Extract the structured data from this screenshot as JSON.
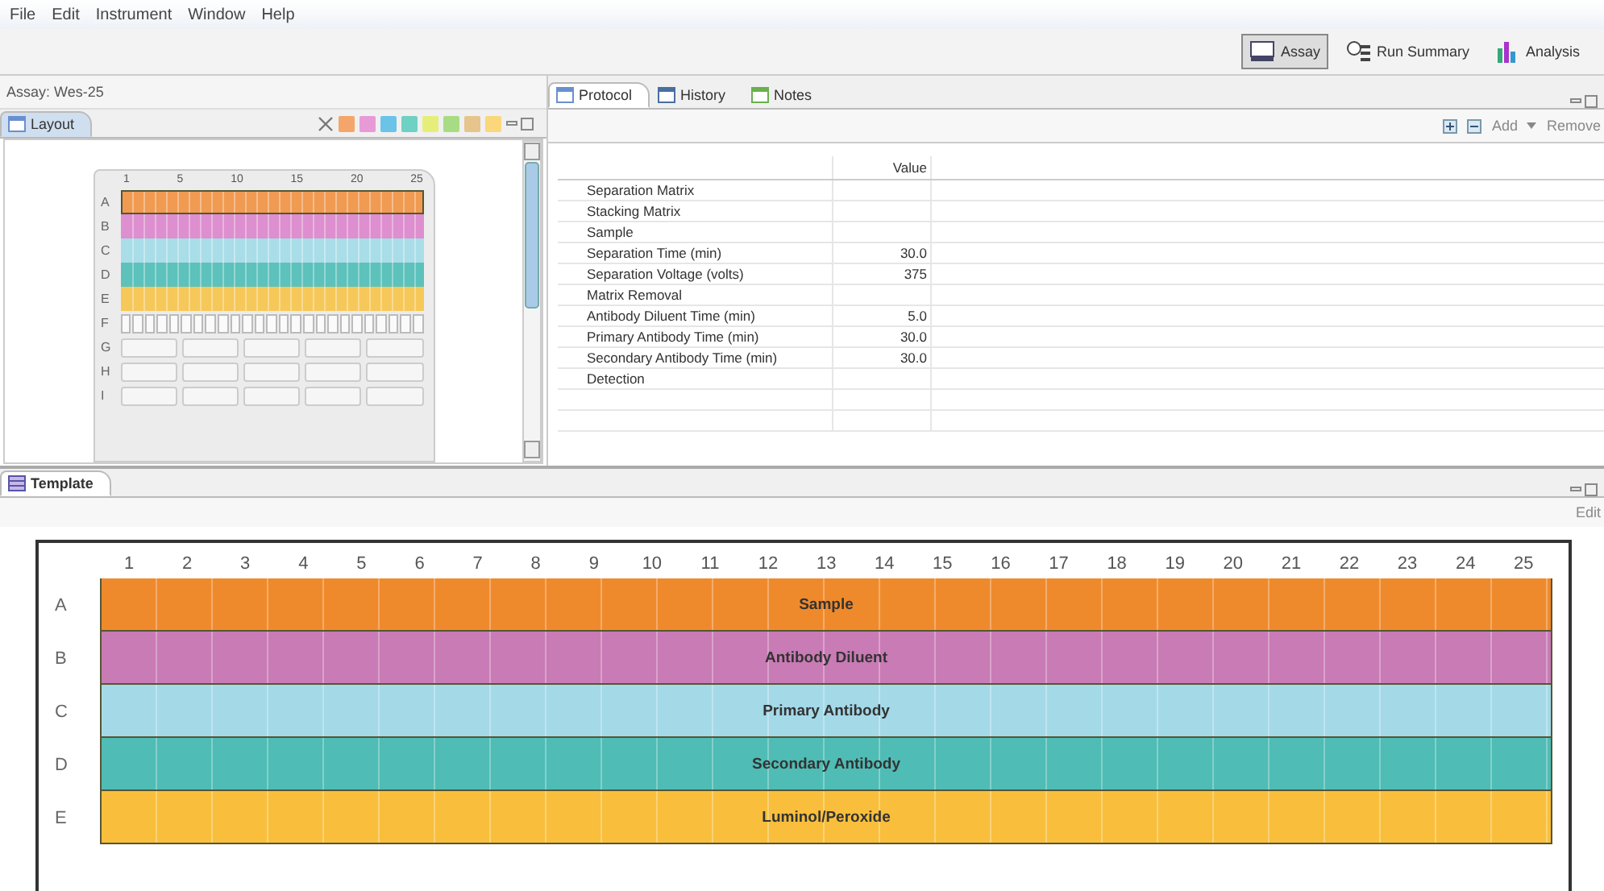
{
  "menu": [
    "File",
    "Edit",
    "Instrument",
    "Window",
    "Help"
  ],
  "perspectives": [
    {
      "label": "Assay",
      "selected": true
    },
    {
      "label": "Run Summary",
      "selected": false
    },
    {
      "label": "Analysis",
      "selected": false
    }
  ],
  "assay_title": "Assay: Wes-25",
  "layout_panel": {
    "tab": {
      "label": "Layout",
      "selected": true
    },
    "reagent_chips": [
      {
        "color": "#f4a66a"
      },
      {
        "color": "#e79ad6"
      },
      {
        "color": "#6cc3e8"
      },
      {
        "color": "#6fd0c4"
      },
      {
        "color": "#e6ee7a"
      },
      {
        "color": "#a8dc84"
      },
      {
        "color": "#e6c48c"
      },
      {
        "color": "#fbd77c"
      }
    ],
    "plate": {
      "columns": [
        "1",
        "5",
        "10",
        "15",
        "20",
        "25"
      ],
      "rows": [
        {
          "label": "A",
          "kind": "lane",
          "color": "#f09a52",
          "selected": true
        },
        {
          "label": "B",
          "kind": "lane",
          "color": "#dd8fcf",
          "selected": false
        },
        {
          "label": "C",
          "kind": "lane",
          "color": "#a9dde8",
          "selected": false
        },
        {
          "label": "D",
          "kind": "lane",
          "color": "#5cc2bb",
          "selected": false
        },
        {
          "label": "E",
          "kind": "lane",
          "color": "#f6c85a",
          "selected": false
        },
        {
          "label": "F",
          "kind": "wells",
          "selected": false
        },
        {
          "label": "G",
          "kind": "blank",
          "selected": false
        },
        {
          "label": "H",
          "kind": "blank",
          "selected": false
        },
        {
          "label": "I",
          "kind": "blank",
          "selected": false
        }
      ]
    }
  },
  "protocol_panel": {
    "tabs": [
      {
        "label": "Protocol",
        "selected": true
      },
      {
        "label": "History",
        "selected": false
      },
      {
        "label": "Notes",
        "selected": false
      }
    ],
    "toolbar": [
      "Add",
      "Remove"
    ],
    "table": {
      "columns": [
        "Value"
      ],
      "rows": [
        {
          "step": "Separation Matrix"
        },
        {
          "step": "Stacking Matrix"
        },
        {
          "step": "Sample"
        },
        {
          "step": "Separation Time (min)",
          "value": "30.0"
        },
        {
          "step": "Separation Voltage (volts)",
          "value": "375"
        },
        {
          "step": "Matrix Removal"
        },
        {
          "step": "Antibody Diluent Time (min)",
          "value": "5.0"
        },
        {
          "step": "Primary Antibody Time (min)",
          "value": "30.0"
        },
        {
          "step": "Secondary Antibody Time (min)",
          "value": "30.0"
        },
        {
          "step": "Detection"
        }
      ]
    }
  },
  "template_panel": {
    "tab": {
      "label": "Template",
      "selected": true
    },
    "toolbar_action": "Edit",
    "columns": [
      "1",
      "2",
      "3",
      "4",
      "5",
      "6",
      "7",
      "8",
      "9",
      "10",
      "11",
      "12",
      "13",
      "14",
      "15",
      "16",
      "17",
      "18",
      "19",
      "20",
      "21",
      "22",
      "23",
      "24",
      "25"
    ],
    "rows": [
      {
        "label": "A",
        "content": "Sample",
        "color": "#ef8a2c"
      },
      {
        "label": "B",
        "content": "Antibody Diluent",
        "color": "#c97bb5"
      },
      {
        "label": "C",
        "content": "Primary Antibody",
        "color": "#a4d9e8"
      },
      {
        "label": "D",
        "content": "Secondary Antibody",
        "color": "#4fbcb5"
      },
      {
        "label": "E",
        "content": "Luminol/Peroxide",
        "color": "#f9bf3c"
      }
    ]
  }
}
